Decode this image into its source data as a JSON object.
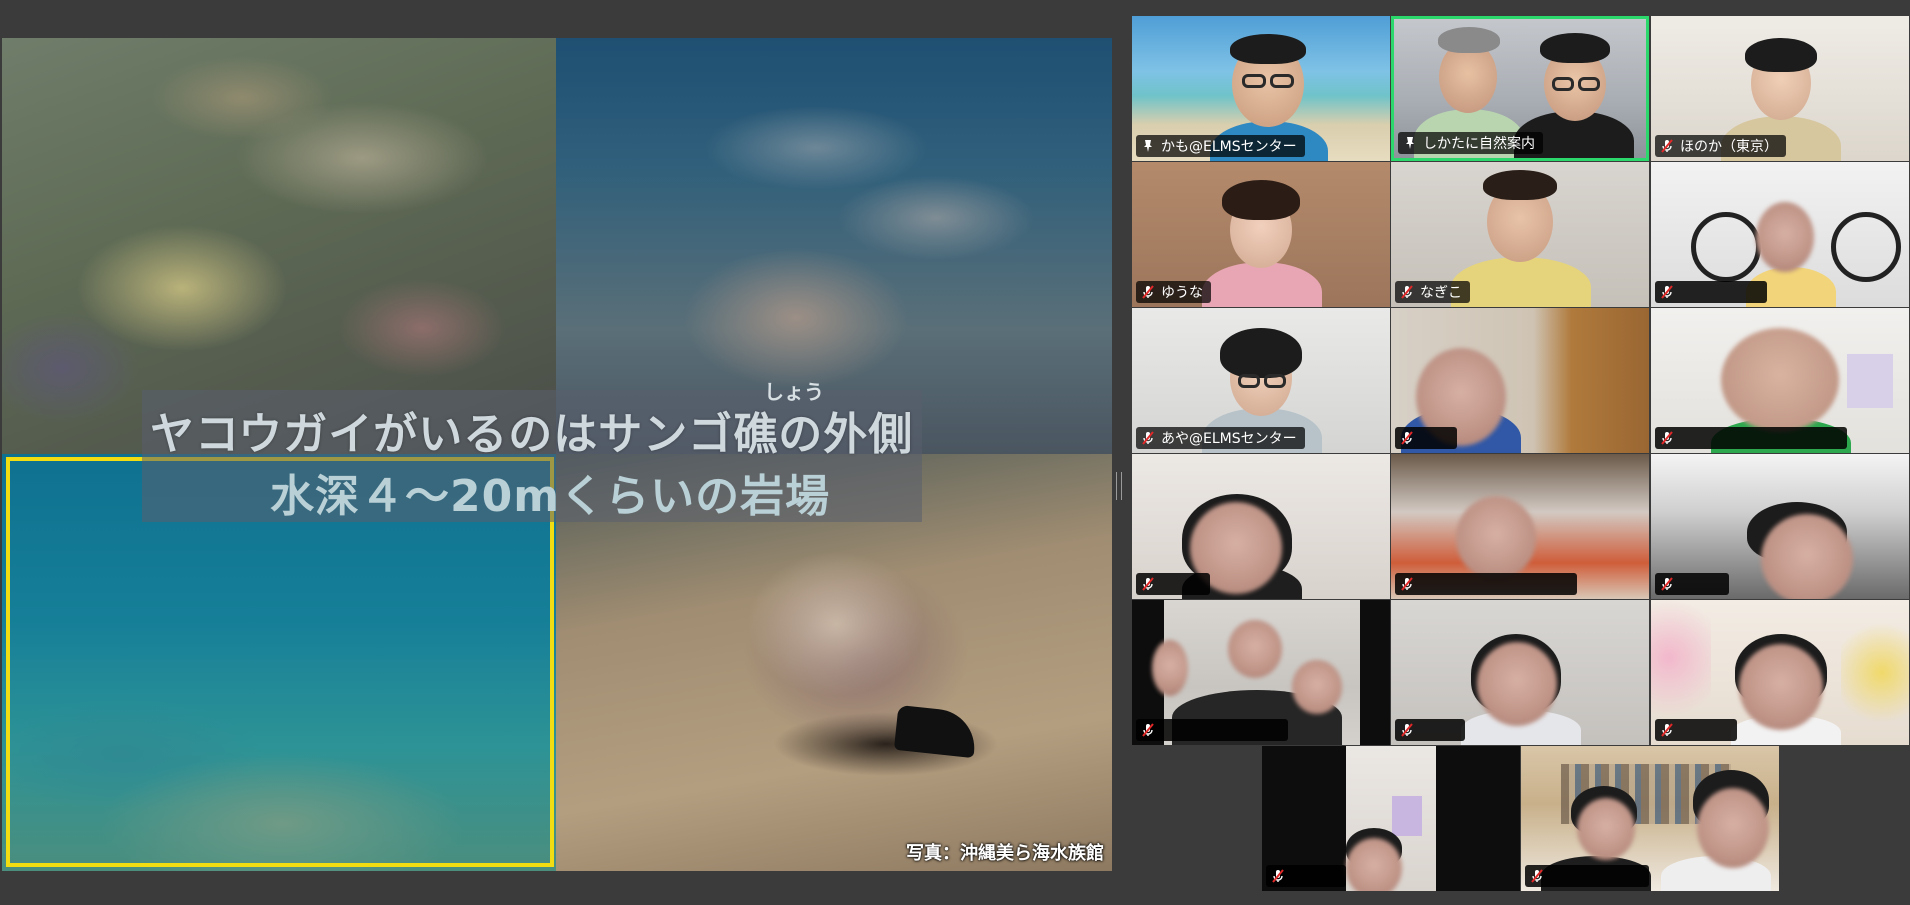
{
  "slide": {
    "caption_line1": "ヤコウガイがいるのはサンゴ礁の外側",
    "ruby": "しょう",
    "caption_line2": "水深４～20mくらいの岩場",
    "credit": "写真：沖縄美ら海水族館"
  },
  "participants": [
    {
      "name": "かも@ELMSセンター",
      "muted": false,
      "pinned_icon": true
    },
    {
      "name": "しかたに自然案内",
      "muted": false,
      "pinned_icon": true,
      "speaking": true
    },
    {
      "name": "ほのか（東京）",
      "muted": true
    },
    {
      "name": "ゆうな",
      "muted": true
    },
    {
      "name": "なぎこ",
      "muted": true
    },
    {
      "name": "",
      "muted": true,
      "redacted": true
    },
    {
      "name": "あや@ELMSセンター",
      "muted": true
    },
    {
      "name": "",
      "muted": true,
      "redacted": true
    },
    {
      "name": "",
      "muted": true,
      "redacted": true
    },
    {
      "name": "",
      "muted": true,
      "redacted": true
    },
    {
      "name": "",
      "muted": true,
      "redacted": true
    },
    {
      "name": "",
      "muted": true,
      "redacted": true
    },
    {
      "name": "",
      "muted": true,
      "redacted": true
    },
    {
      "name": "",
      "muted": true,
      "redacted": true
    },
    {
      "name": "",
      "muted": true,
      "redacted": true
    },
    {
      "name": "",
      "muted": true,
      "redacted": true
    },
    {
      "name": "",
      "muted": true,
      "redacted": true
    }
  ],
  "colors": {
    "speaking_border": "#2ad86b",
    "highlight_frame": "#f2dc12",
    "mic_muted": "#e02828",
    "background": "#3b3b3b"
  },
  "icons": {
    "mic_muted": "mic-muted-icon",
    "unmuted": "mic-icon"
  }
}
